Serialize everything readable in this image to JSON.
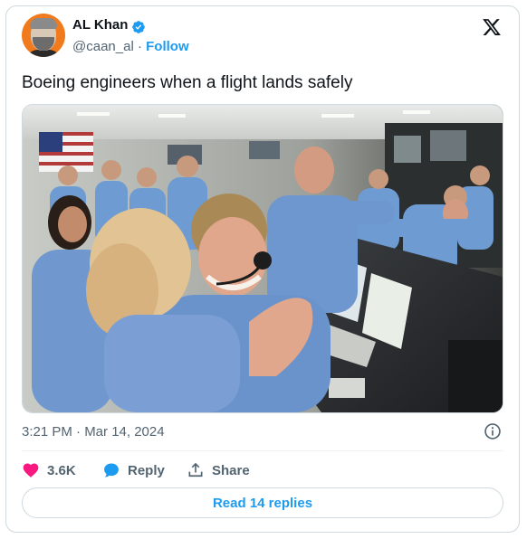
{
  "author": {
    "name": "AL Khan",
    "handle": "@caan_al",
    "separator": "·",
    "follow_label": "Follow"
  },
  "tweet": {
    "text": "Boeing engineers when a flight lands safely",
    "timestamp": "3:21 PM · Mar 14, 2024"
  },
  "actions": {
    "like_count": "3.6K",
    "reply_label": "Reply",
    "share_label": "Share"
  },
  "read_replies_label": "Read 14 replies",
  "icons": [
    "verified-badge-icon",
    "x-logo-icon",
    "info-icon",
    "heart-icon",
    "reply-bubble-icon",
    "share-icon"
  ],
  "colors": {
    "accent": "#1d9bf0",
    "like": "#f91880",
    "text": "#0f1419",
    "muted": "#536471",
    "border": "#cfd9de"
  }
}
